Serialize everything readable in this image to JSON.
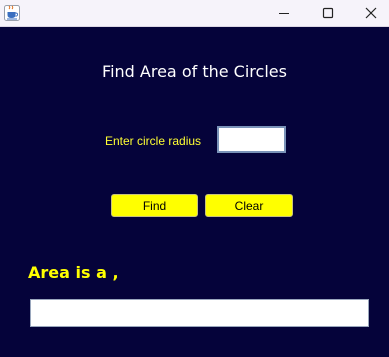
{
  "window": {
    "title": "",
    "icon": "java-coffee-cup-icon",
    "controls": {
      "minimize": "minimize-icon",
      "maximize": "maximize-icon",
      "close": "close-icon"
    }
  },
  "main": {
    "heading": "Find Area of the Circles",
    "radius_label": "Enter circle radius",
    "radius_value": "",
    "find_label": "Find",
    "clear_label": "Clear",
    "result_label": "Area is a ,",
    "result_value": ""
  },
  "colors": {
    "background": "#05033a",
    "label_yellow": "#ffff33",
    "button_yellow": "#ffff00",
    "heading_text": "#ffffff"
  }
}
